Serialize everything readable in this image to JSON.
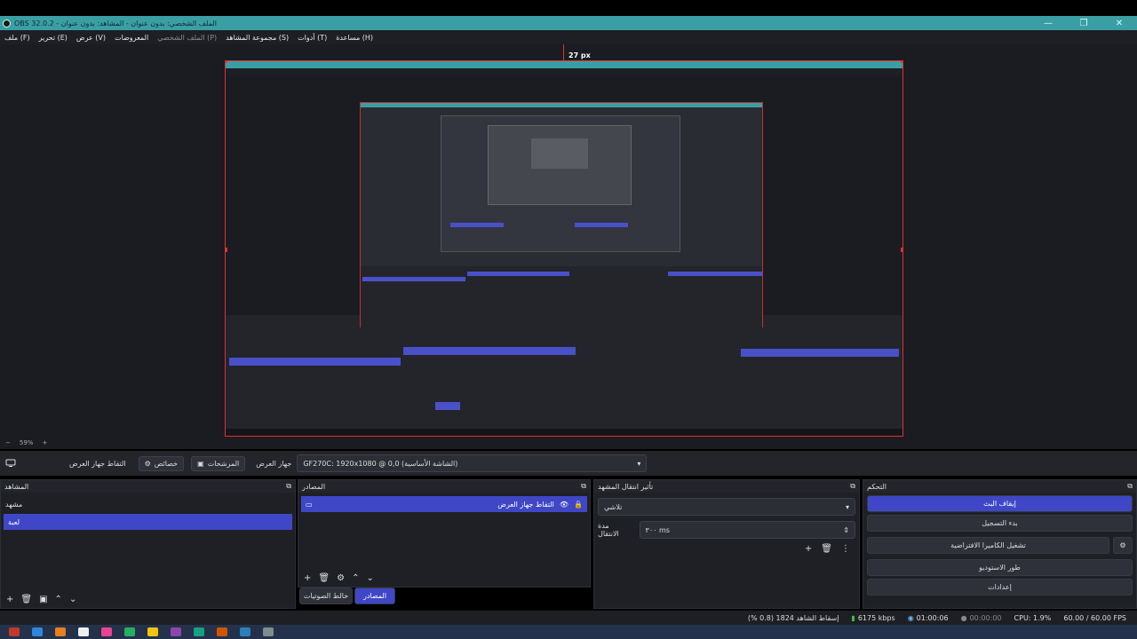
{
  "window": {
    "title": "OBS 32.0.2 - الملف الشخصي: بدون عنوان - المشاهد: بدون عنوان",
    "controls": [
      "—",
      "❐",
      "✕"
    ]
  },
  "menu": {
    "file": "ملف (F)",
    "edit": "تحرير (E)",
    "view": "عرض (V)",
    "docks": "المعروضات",
    "profile": "الملف الشخصي (P)",
    "scene_collection": "مجموعة المشاهد (S)",
    "tools": "أدوات (T)",
    "help": "مساعدة (H)"
  },
  "preview": {
    "offset_label": "27 px",
    "zoom": "59%"
  },
  "source_toolbar": {
    "source_name": "التقاط جهاز العرض",
    "properties": "خصائص",
    "filters": "المرشحات",
    "display_label": "جهاز العرض",
    "display_value": "GF270C: 1920x1080 @ 0,0 (الشاشة الأساسية)"
  },
  "docks": {
    "scenes": {
      "title": "المشاهد",
      "items": [
        "مشهد",
        "لعبة"
      ],
      "selected": 1
    },
    "sources": {
      "title": "المصادر",
      "items": [
        {
          "name": "التقاط جهاز العرض"
        }
      ],
      "tabs": [
        "خالط الصوتيات",
        "المصادر"
      ]
    },
    "transitions": {
      "title": "تأثير انتقال المشهد",
      "type": "تلاشي",
      "duration_label": "مدة الانتقال",
      "duration_value": "٣٠٠ ms"
    },
    "controls": {
      "title": "التحكم",
      "buttons": {
        "stream": "إيقاف البث",
        "record": "بدء التسجيل",
        "virtual_cam": "تشغيل الكاميرا الافتراضية",
        "studio": "طور الاستوديو",
        "settings": "إعدادات"
      }
    }
  },
  "status": {
    "dropped": "إسقاط الشاهد 1824 (0.8 %)",
    "bitrate": "6175 kbps",
    "stream_time": "01:00:06",
    "rec_time": "00:00:00",
    "cpu": "CPU: 1.9%",
    "fps": "60.00 / 60.00 FPS"
  },
  "colors": {
    "accent": "#3f47c6",
    "titlebar": "#3a9fa4",
    "panel": "#1e2026",
    "selection_border": "#e03030"
  }
}
